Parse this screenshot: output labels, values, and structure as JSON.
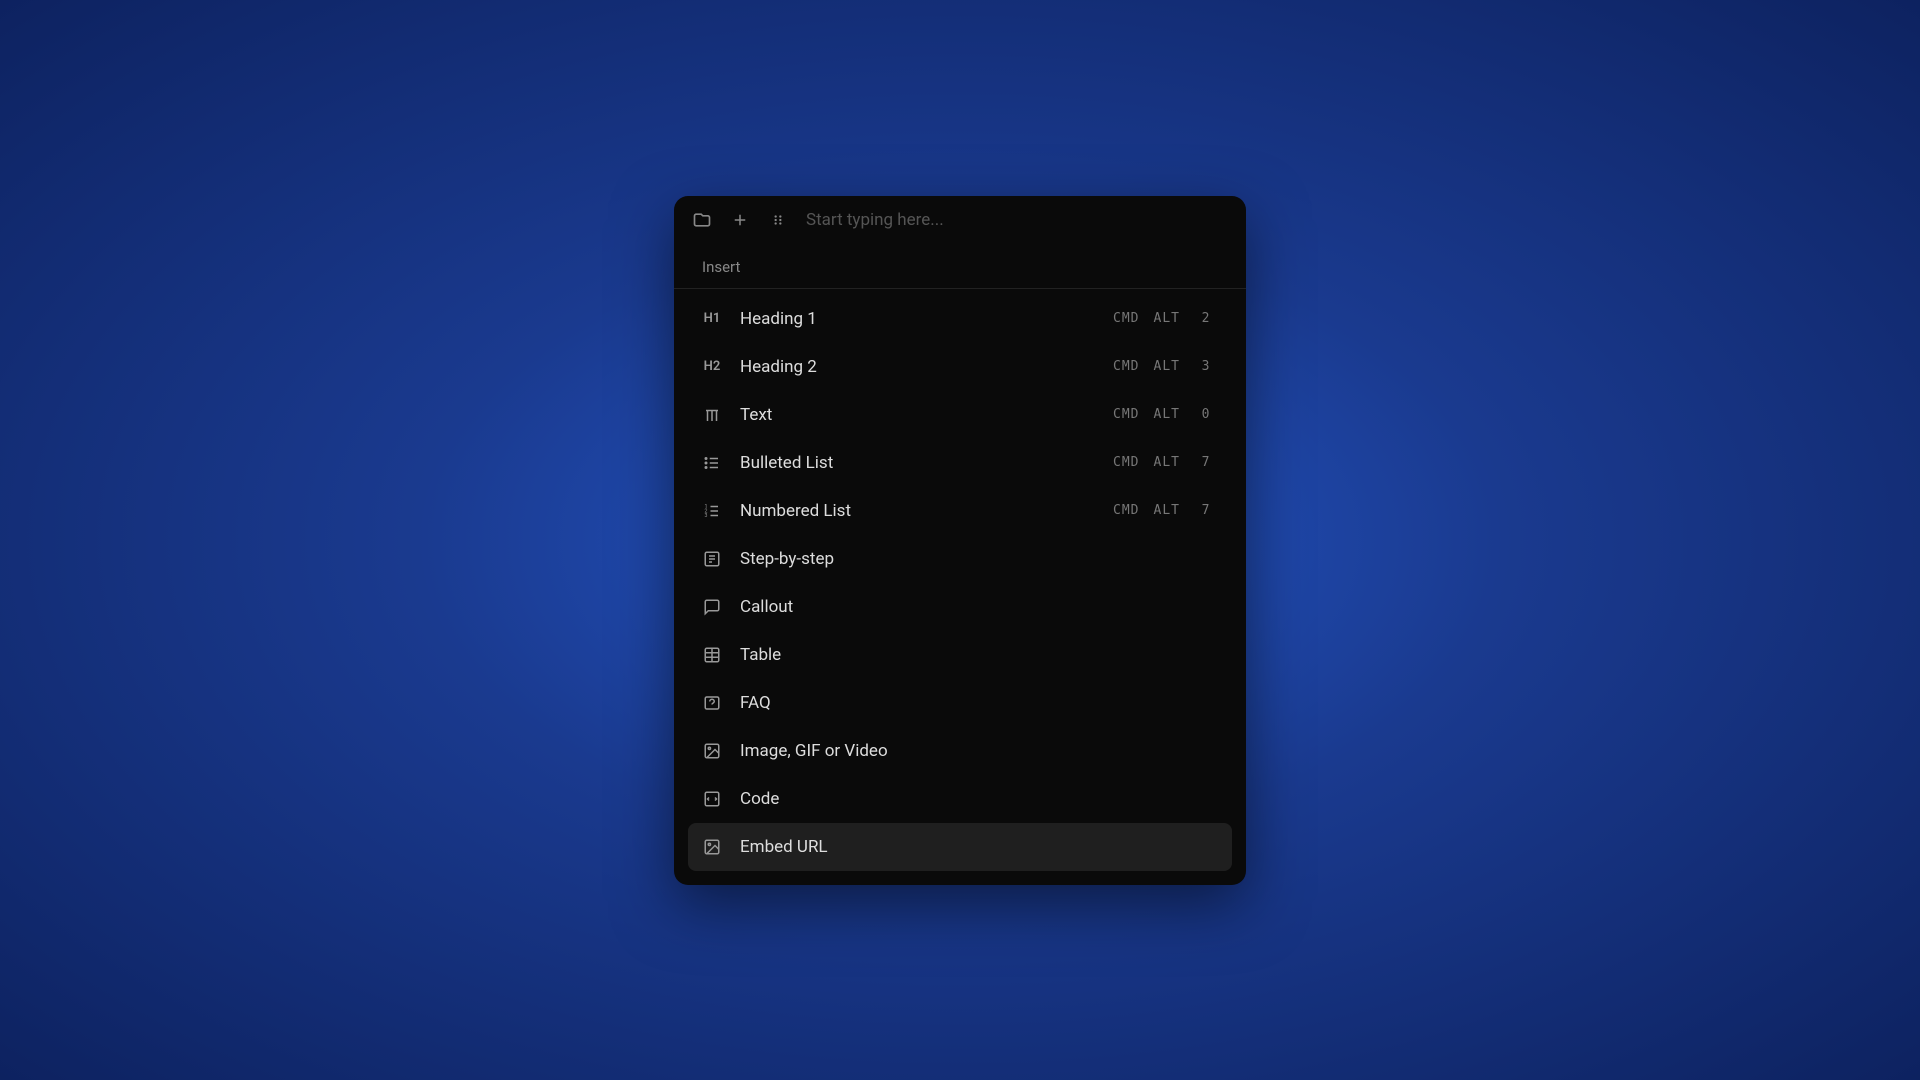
{
  "input": {
    "placeholder": "Start typing here..."
  },
  "section": {
    "title": "Insert"
  },
  "items": [
    {
      "icon_text": "H1",
      "label": "Heading 1",
      "shortcut": [
        "CMD",
        "ALT",
        "2"
      ]
    },
    {
      "icon_text": "H2",
      "label": "Heading 2",
      "shortcut": [
        "CMD",
        "ALT",
        "3"
      ]
    },
    {
      "icon": "text",
      "label": "Text",
      "shortcut": [
        "CMD",
        "ALT",
        "0"
      ]
    },
    {
      "icon": "bullet-list",
      "label": "Bulleted List",
      "shortcut": [
        "CMD",
        "ALT",
        "7"
      ]
    },
    {
      "icon": "numbered-list",
      "label": "Numbered List",
      "shortcut": [
        "CMD",
        "ALT",
        "7"
      ]
    },
    {
      "icon": "steps",
      "label": "Step-by-step"
    },
    {
      "icon": "callout",
      "label": "Callout"
    },
    {
      "icon": "table",
      "label": "Table"
    },
    {
      "icon": "faq",
      "label": "FAQ"
    },
    {
      "icon": "image",
      "label": "Image, GIF or Video"
    },
    {
      "icon": "code",
      "label": "Code"
    },
    {
      "icon": "embed",
      "label": "Embed URL",
      "highlighted": true
    }
  ]
}
